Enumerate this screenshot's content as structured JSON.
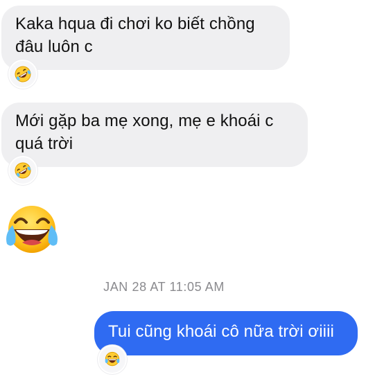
{
  "messages": [
    {
      "direction": "incoming",
      "text": "Kaka hqua đi chơi ko biết chồng đâu luôn c",
      "reaction": "rolling-on-floor-laughing"
    },
    {
      "direction": "incoming",
      "text": "Mới gặp ba mẹ xong, mẹ e khoái c quá trời",
      "reaction": "rolling-on-floor-laughing"
    },
    {
      "direction": "incoming",
      "emoji": "face-with-tears-of-joy"
    },
    {
      "direction": "outgoing",
      "text": "Tui cũng khoái cô nữa trời ơiiii",
      "reaction": "face-with-tears-of-joy"
    }
  ],
  "timestamp": "JAN 28 AT 11:05 AM",
  "colors": {
    "incoming_bubble": "#efeff1",
    "outgoing_bubble": "#2f6bf2",
    "timestamp": "#8a8a8e"
  }
}
